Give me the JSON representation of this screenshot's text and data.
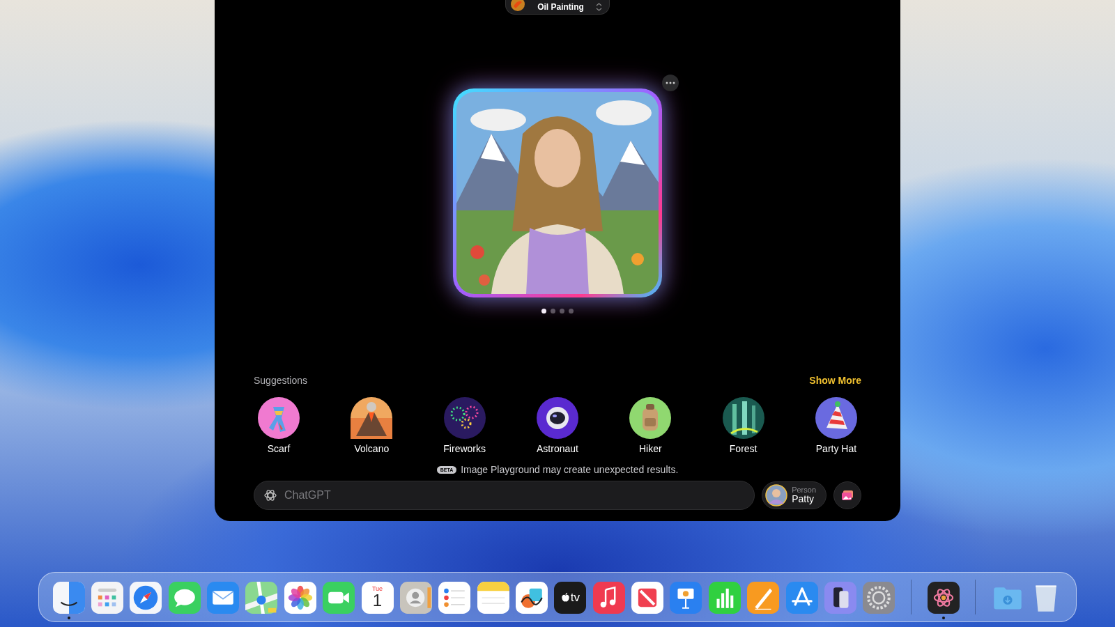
{
  "style_picker": {
    "label": "Oil Painting"
  },
  "carousel": [
    {
      "selected": true
    },
    {
      "selected": false
    },
    {
      "selected": false
    },
    {
      "selected": false
    }
  ],
  "suggestions": {
    "title": "Suggestions",
    "show_more": "Show More",
    "items": [
      {
        "label": "Scarf",
        "kind": "scarf"
      },
      {
        "label": "Volcano",
        "kind": "volcano"
      },
      {
        "label": "Fireworks",
        "kind": "fireworks"
      },
      {
        "label": "Astronaut",
        "kind": "astronaut"
      },
      {
        "label": "Hiker",
        "kind": "hiker"
      },
      {
        "label": "Forest",
        "kind": "forest"
      },
      {
        "label": "Party Hat",
        "kind": "hat"
      }
    ]
  },
  "notice": {
    "badge": "BETA",
    "text": "Image Playground may create unexpected results."
  },
  "prompt": {
    "placeholder": "ChatGPT"
  },
  "person": {
    "caption": "Person",
    "name": "Patty"
  },
  "dock": [
    {
      "kind": "finder",
      "running": true
    },
    {
      "kind": "launchpad",
      "running": false
    },
    {
      "kind": "safari",
      "running": false
    },
    {
      "kind": "messages",
      "running": false
    },
    {
      "kind": "mail",
      "running": false
    },
    {
      "kind": "maps",
      "running": false
    },
    {
      "kind": "photos",
      "running": false
    },
    {
      "kind": "facetime",
      "running": false
    },
    {
      "kind": "calendar",
      "running": false,
      "day": "Tue",
      "date": "1"
    },
    {
      "kind": "contacts",
      "running": false
    },
    {
      "kind": "reminders",
      "running": false
    },
    {
      "kind": "notes",
      "running": false
    },
    {
      "kind": "freeform",
      "running": false
    },
    {
      "kind": "tv",
      "running": false,
      "text": "tv"
    },
    {
      "kind": "music",
      "running": false
    },
    {
      "kind": "news",
      "running": false
    },
    {
      "kind": "keynote",
      "running": false
    },
    {
      "kind": "numbers",
      "running": false
    },
    {
      "kind": "pages",
      "running": false
    },
    {
      "kind": "appstore",
      "running": false
    },
    {
      "kind": "iphone",
      "running": false
    },
    {
      "kind": "settings",
      "running": false
    },
    {
      "kind": "separator"
    },
    {
      "kind": "playground",
      "running": true
    },
    {
      "kind": "separator"
    },
    {
      "kind": "downloads",
      "running": false
    },
    {
      "kind": "trash",
      "running": false
    }
  ]
}
